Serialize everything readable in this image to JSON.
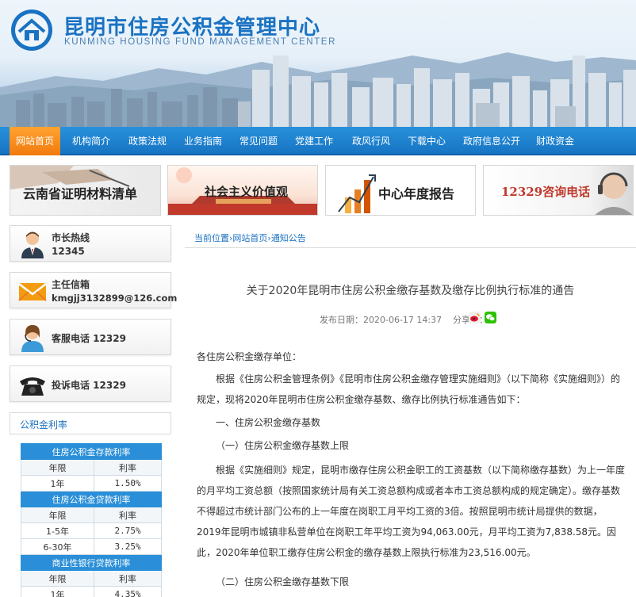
{
  "header": {
    "org_name_cn": "昆明市住房公积金管理中心",
    "org_name_en": "KUNMING HOUSING FUND MANAGEMENT CENTER",
    "brand_color": "#1a72c2",
    "nav_color": "#1774c3",
    "active_color": "#f17a0d"
  },
  "nav": {
    "items": [
      "网站首页",
      "机构简介",
      "政策法规",
      "业务指南",
      "常见问题",
      "党建工作",
      "政风行风",
      "下载中心",
      "政府信息公开",
      "财政资金"
    ],
    "active_index": 0
  },
  "promos": [
    {
      "text": "云南省证明材料清单",
      "icon": "hand-writing-photo"
    },
    {
      "text": "社会主义价值观",
      "icon": "tiananmen-photo"
    },
    {
      "text": "中心年度报告",
      "icon": "bar-chart-arrow"
    },
    {
      "text": "12329咨询电话",
      "icon": "headset-agent-photo"
    }
  ],
  "sidebar": {
    "cards": [
      {
        "label": "市长热线",
        "value": "12345",
        "icon": "person-suit-icon"
      },
      {
        "label": "主任信箱",
        "value": "kmgjj3132899@126.com",
        "icon": "envelope-icon"
      },
      {
        "label": "客服电话 12329",
        "value": "",
        "icon": "service-agent-icon"
      },
      {
        "label": "投诉电话 12329",
        "value": "",
        "icon": "telephone-icon"
      }
    ],
    "rates_title": "公积金利率",
    "rate_tables": [
      {
        "title": "住房公积金存款利率",
        "col1": "年限",
        "col2": "利率",
        "rows": [
          [
            "1年",
            "1.50%"
          ]
        ]
      },
      {
        "title": "住房公积金贷款利率",
        "col1": "年限",
        "col2": "利率",
        "rows": [
          [
            "1-5年",
            "2.75%"
          ],
          [
            "6-30年",
            "3.25%"
          ]
        ]
      },
      {
        "title": "商业性银行贷款利率",
        "col1": "年限",
        "col2": "利率",
        "rows": [
          [
            "1年",
            "4.35%"
          ]
        ]
      }
    ]
  },
  "breadcrumb": {
    "label": "当前位置",
    "items": [
      "网站首页",
      "通知公告"
    ],
    "separator": "›"
  },
  "article": {
    "title": "关于2020年昆明市住房公积金缴存基数及缴存比例执行标准的通告",
    "date_label": "发布日期：",
    "date": "2020-06-17 14:37",
    "share_label": "分享到：",
    "paragraphs": [
      "各住房公积金缴存单位：",
      "根据《住房公积金管理条例》《昆明市住房公积金缴存管理实施细则》（以下简称《实施细则》）的规定，现将2020年昆明市住房公积金缴存基数、缴存比例执行标准通告如下：",
      "一、住房公积金缴存基数",
      "（一）住房公积金缴存基数上限",
      "根据《实施细则》规定，昆明市缴存住房公积金职工的工资基数（以下简称缴存基数）为上一年度的月平均工资总额（按照国家统计局有关工资总额构成或者本市工资总额构成的规定确定）。缴存基数不得超过市统计部门公布的上一年度在岗职工月平均工资的3倍。按照昆明市统计局提供的数据，2019年昆明市城镇非私营单位在岗职工年平均工资为94,063.00元，月平均工资为7,838.58元。因此，2020年单位职工缴存住房公积金的缴存基数上限执行标准为23,516.00元。",
      "（二）住房公积金缴存基数下限"
    ]
  }
}
